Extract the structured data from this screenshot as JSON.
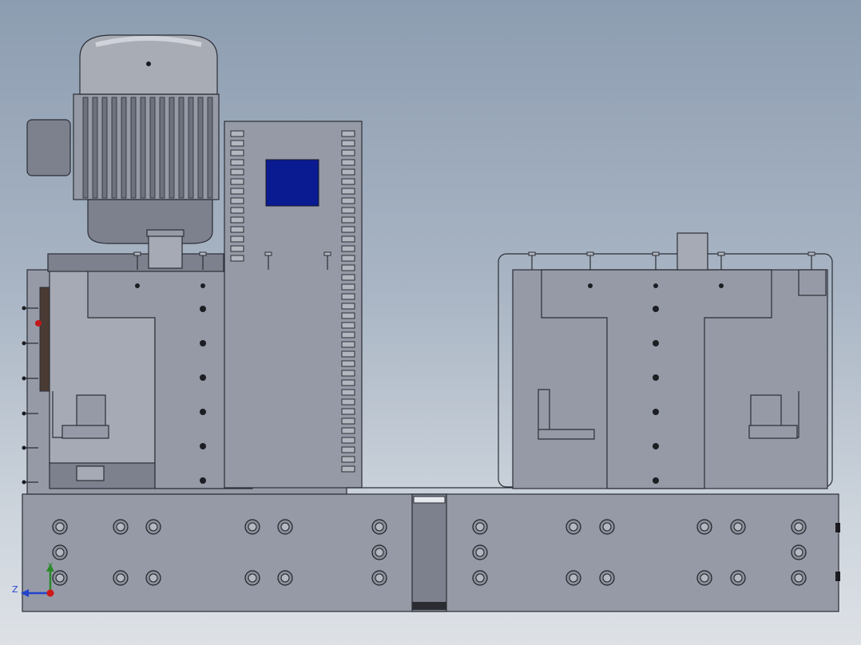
{
  "viewport": {
    "background_top": "#8d9db1",
    "background_bottom": "#dde1e6"
  },
  "model": {
    "display_panel_color": "#0a1a90",
    "part_color": "#969aa6",
    "edge_color": "#2b2e36"
  },
  "triad": {
    "x_label": "Y",
    "z_label": "Z",
    "x_color": "#2a8a2a",
    "z_color": "#2244cc",
    "origin_color": "#d01818"
  }
}
